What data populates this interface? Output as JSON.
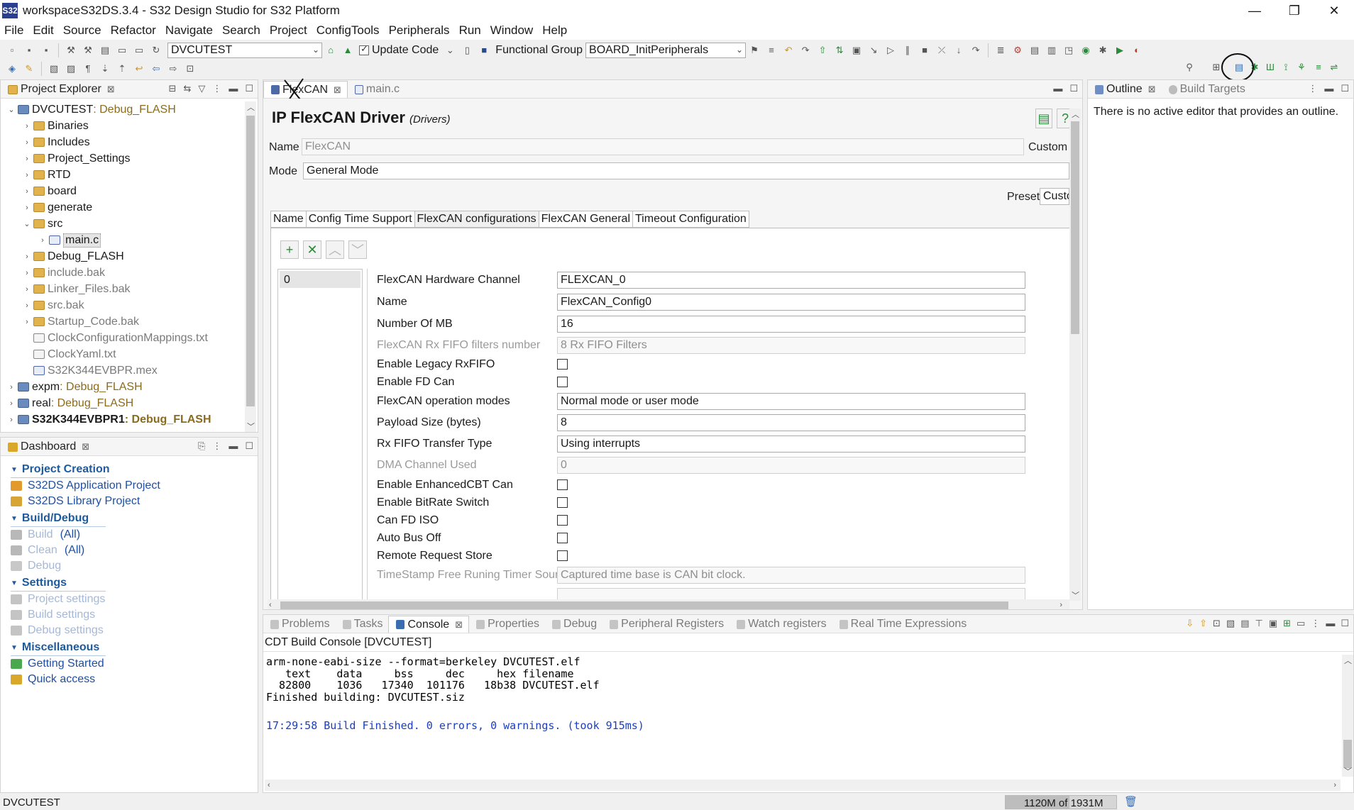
{
  "window": {
    "title": "workspaceS32DS.3.4 - S32 Design Studio for S32 Platform",
    "app_icon_label": "S32",
    "minimize": "—",
    "restore": "❐",
    "close": "✕"
  },
  "menu": [
    "File",
    "Edit",
    "Source",
    "Refactor",
    "Navigate",
    "Search",
    "Project",
    "ConfigTools",
    "Peripherals",
    "Run",
    "Window",
    "Help"
  ],
  "toolbar": {
    "project_combo": "DVCUTEST",
    "update_code": "Update Code",
    "functional_group_label": "Functional Group",
    "functional_group_value": "BOARD_InitPeripherals"
  },
  "project_explorer": {
    "title": "Project Explorer",
    "items": [
      {
        "twisty": "⌄",
        "indent": 0,
        "icon": "project",
        "label": "DVCUTEST",
        "suffix": ": Debug_FLASH",
        "style": "normal"
      },
      {
        "twisty": "›",
        "indent": 1,
        "icon": "folder",
        "label": "Binaries",
        "suffix": "",
        "style": "normal"
      },
      {
        "twisty": "›",
        "indent": 1,
        "icon": "folder",
        "label": "Includes",
        "suffix": "",
        "style": "normal"
      },
      {
        "twisty": "›",
        "indent": 1,
        "icon": "folder",
        "label": "Project_Settings",
        "suffix": "",
        "style": "normal"
      },
      {
        "twisty": "›",
        "indent": 1,
        "icon": "folder",
        "label": "RTD",
        "suffix": "",
        "style": "normal"
      },
      {
        "twisty": "›",
        "indent": 1,
        "icon": "folder",
        "label": "board",
        "suffix": "",
        "style": "normal"
      },
      {
        "twisty": "›",
        "indent": 1,
        "icon": "folder",
        "label": "generate",
        "suffix": "",
        "style": "normal"
      },
      {
        "twisty": "⌄",
        "indent": 1,
        "icon": "folder",
        "label": "src",
        "suffix": "",
        "style": "normal"
      },
      {
        "twisty": "›",
        "indent": 2,
        "icon": "filec",
        "label": "main.c",
        "suffix": "",
        "style": "selected"
      },
      {
        "twisty": "›",
        "indent": 1,
        "icon": "folder",
        "label": "Debug_FLASH",
        "suffix": "",
        "style": "normal"
      },
      {
        "twisty": "›",
        "indent": 1,
        "icon": "folder",
        "label": "include.bak",
        "suffix": "",
        "style": "gray"
      },
      {
        "twisty": "›",
        "indent": 1,
        "icon": "folder",
        "label": "Linker_Files.bak",
        "suffix": "",
        "style": "gray"
      },
      {
        "twisty": "›",
        "indent": 1,
        "icon": "folder",
        "label": "src.bak",
        "suffix": "",
        "style": "gray"
      },
      {
        "twisty": "›",
        "indent": 1,
        "icon": "folder",
        "label": "Startup_Code.bak",
        "suffix": "",
        "style": "gray"
      },
      {
        "twisty": "",
        "indent": 1,
        "icon": "file",
        "label": "ClockConfigurationMappings.txt",
        "suffix": "",
        "style": "gray"
      },
      {
        "twisty": "",
        "indent": 1,
        "icon": "file",
        "label": "ClockYaml.txt",
        "suffix": "",
        "style": "gray"
      },
      {
        "twisty": "",
        "indent": 1,
        "icon": "filec",
        "label": "S32K344EVBPR.mex",
        "suffix": "",
        "style": "gray"
      },
      {
        "twisty": "›",
        "indent": 0,
        "icon": "project",
        "label": "expm",
        "suffix": ": Debug_FLASH",
        "style": "normal"
      },
      {
        "twisty": "›",
        "indent": 0,
        "icon": "project",
        "label": "real",
        "suffix": ": Debug_FLASH",
        "style": "normal"
      },
      {
        "twisty": "›",
        "indent": 0,
        "icon": "project",
        "label": "S32K344EVBPR1",
        "suffix": ": Debug_FLASH",
        "style": "bold"
      }
    ]
  },
  "dashboard": {
    "title": "Dashboard",
    "sections": [
      {
        "title": "Project Creation",
        "items": [
          {
            "label": "S32DS Application Project",
            "extra": "",
            "state": "link",
            "icon_color": "#e39a2d"
          },
          {
            "label": "S32DS Library Project",
            "extra": "",
            "state": "link",
            "icon_color": "#d8a436"
          }
        ]
      },
      {
        "title": "Build/Debug",
        "items": [
          {
            "label": "Build",
            "extra": "(All)",
            "state": "dim",
            "icon_color": "#b8b8b8"
          },
          {
            "label": "Clean",
            "extra": "(All)",
            "state": "dim",
            "icon_color": "#b8b8b8"
          },
          {
            "label": "Debug",
            "extra": "",
            "state": "dim",
            "icon_color": "#c8c8c8"
          }
        ]
      },
      {
        "title": "Settings",
        "items": [
          {
            "label": "Project settings",
            "extra": "",
            "state": "dim",
            "icon_color": "#c4c4c4"
          },
          {
            "label": "Build settings",
            "extra": "",
            "state": "dim",
            "icon_color": "#c4c4c4"
          },
          {
            "label": "Debug settings",
            "extra": "",
            "state": "dim",
            "icon_color": "#c4c4c4"
          }
        ]
      },
      {
        "title": "Miscellaneous",
        "items": [
          {
            "label": "Getting Started",
            "extra": "",
            "state": "link",
            "icon_color": "#4aa84f"
          },
          {
            "label": "Quick access",
            "extra": "",
            "state": "link",
            "icon_color": "#d9a72a"
          }
        ]
      }
    ]
  },
  "editor": {
    "tabs": [
      {
        "label": "FlexCAN",
        "active": true
      },
      {
        "label": "main.c",
        "active": false
      }
    ],
    "heading": "IP FlexCAN Driver",
    "heading_sub": "(Drivers)",
    "name_label": "Name",
    "name_value": "FlexCAN",
    "custom_label": "Custom",
    "mode_label": "Mode",
    "mode_value": "General Mode",
    "preset_label": "Preset",
    "preset_value": "Custo",
    "subtabs": [
      "Name",
      "Config Time Support",
      "FlexCAN configurations",
      "FlexCAN General",
      "Timeout Configuration"
    ],
    "active_subtab": 2,
    "list_items": [
      "0"
    ],
    "rows": [
      {
        "label": "FlexCAN Hardware Channel",
        "type": "text",
        "value": "FLEXCAN_0",
        "disabled": false
      },
      {
        "label": "Name",
        "type": "text",
        "value": "FlexCAN_Config0",
        "disabled": false
      },
      {
        "label": "Number Of MB",
        "type": "text",
        "value": "16",
        "disabled": false
      },
      {
        "label": "FlexCAN Rx FIFO filters number",
        "type": "text",
        "value": "8 Rx FIFO Filters",
        "disabled": true
      },
      {
        "label": "Enable Legacy RxFIFO",
        "type": "check",
        "value": "",
        "disabled": false
      },
      {
        "label": "Enable FD Can",
        "type": "check",
        "value": "",
        "disabled": false
      },
      {
        "label": "FlexCAN operation modes",
        "type": "text",
        "value": "Normal mode or user mode",
        "disabled": false
      },
      {
        "label": "Payload Size (bytes)",
        "type": "text",
        "value": "8",
        "disabled": false
      },
      {
        "label": "Rx FIFO Transfer Type",
        "type": "text",
        "value": "Using interrupts",
        "disabled": false
      },
      {
        "label": "DMA Channel Used",
        "type": "text",
        "value": "0",
        "disabled": true
      },
      {
        "label": "Enable EnhancedCBT Can",
        "type": "check",
        "value": "",
        "disabled": false
      },
      {
        "label": "Enable BitRate Switch",
        "type": "check",
        "value": "",
        "disabled": false
      },
      {
        "label": "Can FD ISO",
        "type": "check",
        "value": "",
        "disabled": false
      },
      {
        "label": "Auto Bus Off",
        "type": "check",
        "value": "",
        "disabled": false
      },
      {
        "label": "Remote Request Store",
        "type": "check",
        "value": "",
        "disabled": false
      },
      {
        "label": "TimeStamp Free Runing Timer Source",
        "type": "text",
        "value": "Captured time base is CAN bit clock.",
        "disabled": true
      }
    ]
  },
  "outline": {
    "tabs": [
      {
        "label": "Outline",
        "active": true
      },
      {
        "label": "Build Targets",
        "active": false
      }
    ],
    "message": "There is no active editor that provides an outline."
  },
  "bottom": {
    "tabs": [
      {
        "label": "Problems",
        "active": false
      },
      {
        "label": "Tasks",
        "active": false
      },
      {
        "label": "Console",
        "active": true
      },
      {
        "label": "Properties",
        "active": false
      },
      {
        "label": "Debug",
        "active": false
      },
      {
        "label": "Peripheral Registers",
        "active": false
      },
      {
        "label": "Watch registers",
        "active": false
      },
      {
        "label": "Real Time Expressions",
        "active": false
      }
    ],
    "console_title": "CDT Build Console [DVCUTEST]",
    "console_lines": [
      "arm-none-eabi-size --format=berkeley DVCUTEST.elf",
      "   text    data     bss     dec     hex filename",
      "  82800    1036   17340  101176   18b38 DVCUTEST.elf",
      "Finished building: DVCUTEST.siz"
    ],
    "console_finish": "17:29:58 Build Finished. 0 errors, 0 warnings. (took 915ms)",
    "finish_color": "#1a3fc0"
  },
  "statusbar": {
    "left": "DVCUTEST",
    "heap": "1120M of 1931M"
  }
}
